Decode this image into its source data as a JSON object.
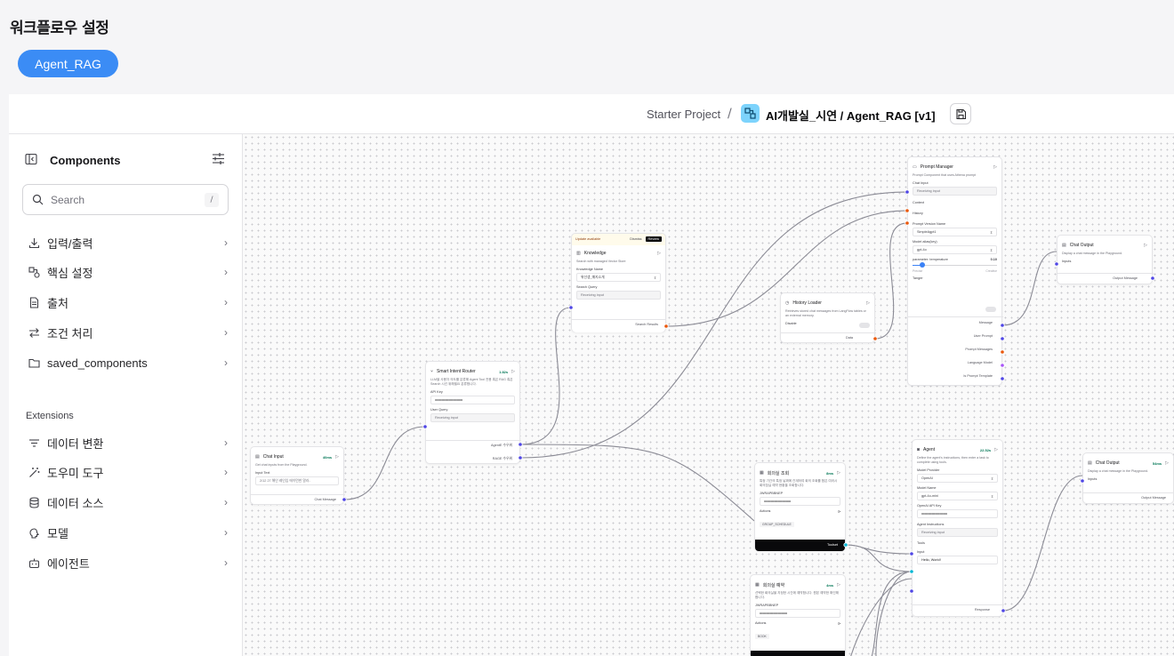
{
  "page": {
    "title": "워크플로우 설정",
    "flow_chip": "Agent_RAG"
  },
  "header": {
    "breadcrumb_project": "Starter Project",
    "breadcrumb_sep": "/",
    "flow_name": "AI개발실_시연 / Agent_RAG [v1]"
  },
  "sidebar": {
    "title": "Components",
    "search_placeholder": "Search",
    "search_shortcut": "/",
    "categories": [
      {
        "label": "입력/출력",
        "icon": "download-icon"
      },
      {
        "label": "핵심 설정",
        "icon": "shapes-icon"
      },
      {
        "label": "출처",
        "icon": "file-text-icon"
      },
      {
        "label": "조건 처리",
        "icon": "arrows-icon"
      },
      {
        "label": "saved_components",
        "icon": "folder-icon"
      }
    ],
    "extensions_title": "Extensions",
    "extensions": [
      {
        "label": "데이터 변환",
        "icon": "filter-icon"
      },
      {
        "label": "도우미 도구",
        "icon": "magic-wand-icon"
      },
      {
        "label": "데이터 소스",
        "icon": "database-icon"
      },
      {
        "label": "모델",
        "icon": "brain-icon"
      },
      {
        "label": "에이전트",
        "icon": "bot-icon"
      }
    ]
  },
  "nodes": {
    "chat_input": {
      "title": "Chat Input",
      "badge": "40ms",
      "desc": "Get chat inputs from the Playground.",
      "field": "Input Text",
      "value": "2/12 27 해인 레인임 에이먼한 알라..",
      "output": "Chat Message"
    },
    "router": {
      "title": "Smart Intent Router",
      "badge": "1.82s",
      "desc": "LLM을 사용자 의도를 분류해 Agent Tool 전용 혹은 RAG 혹은 Search 시킨 위해필요 분류합니다.",
      "field1": "API Key",
      "field2": "User Query",
      "value2": "Receiving input",
      "out1": "AgentE 수우워",
      "out2": "RAGE 수우워"
    },
    "knowledge": {
      "update": "Update available",
      "dismiss": "Dismiss",
      "review": "Review",
      "title": "Knowledge",
      "desc": "Search with managed Vector Store",
      "field1": "Knowledge Name",
      "value1": "위선생_매지소개",
      "field2": "Search Query",
      "value2": "Receiving input",
      "output": "Search Results"
    },
    "history": {
      "title": "History Loader",
      "desc": "Retrieves stored chat messages from LangFlow tables or an external memory.",
      "field": "Disable",
      "output": "Data"
    },
    "prompt": {
      "title": "Prompt Manager",
      "desc": "Prompt Component that uses Athena prompt",
      "f1": "Chat Input",
      "v1": "Receiving input",
      "f2": "Context",
      "f3": "History",
      "f4": "Prompt Version Name",
      "v4": "SimpleAgpt1",
      "f5": "Model alias(key)",
      "v5": "gpt-4o",
      "f6": "parameter: temperature",
      "v6": "0.10",
      "min": "Precise",
      "max": "Creative",
      "f7": "Tanger",
      "outs": [
        "Message",
        "User Prompt",
        "Prompt Messages",
        "Language Model",
        "Is Prompt Template"
      ]
    },
    "chat_output1": {
      "title": "Chat Output",
      "desc": "Display a chat message in the Playground.",
      "field": "Inputs",
      "output": "Output Message"
    },
    "tool1": {
      "title": "회의실 조회",
      "badge": "8ms",
      "desc": "특정 기간의 특정 날짜에 관계하여 회의 조회를 합은 여러시 회의참실 예약 현황을 조회합니다.",
      "field": "JWRAPBBNEP",
      "actions": "Actions",
      "pill": "GROUP_SCHEDULE",
      "output": "Toolset"
    },
    "tool2": {
      "title": "회의실 예약",
      "badge": "4ms",
      "desc": "선택한 회의실을 지정한 시간에 예약합니다. 원본 예약한 확인해합니다.",
      "field": "JWRAPBBNEP",
      "actions": "Actions",
      "pill": "BOOK"
    },
    "agent": {
      "title": "Agent",
      "badge": "22.52s",
      "desc": "Define the agent's instructions, then enter a task to complete using tools.",
      "f1": "Model Provider",
      "v1": "OpenAI",
      "f2": "Model Name",
      "v2": "gpt-4o-mini",
      "f3": "OpenAI API Key",
      "f4": "Agent Instructions",
      "v4": "Receiving input",
      "f5": "Tools",
      "f6": "Input",
      "v6": "Hello, World!",
      "output": "Response"
    },
    "chat_output2": {
      "title": "Chat Output",
      "badge": "54ms",
      "desc": "Display a chat message in the Playground.",
      "field": "Inputs",
      "output": "Output Message"
    }
  },
  "colors": {
    "accent": "#3b8cf5",
    "handle_blue": "#4f46e5",
    "handle_orange": "#ea580c",
    "handle_cyan": "#06b6d4"
  }
}
